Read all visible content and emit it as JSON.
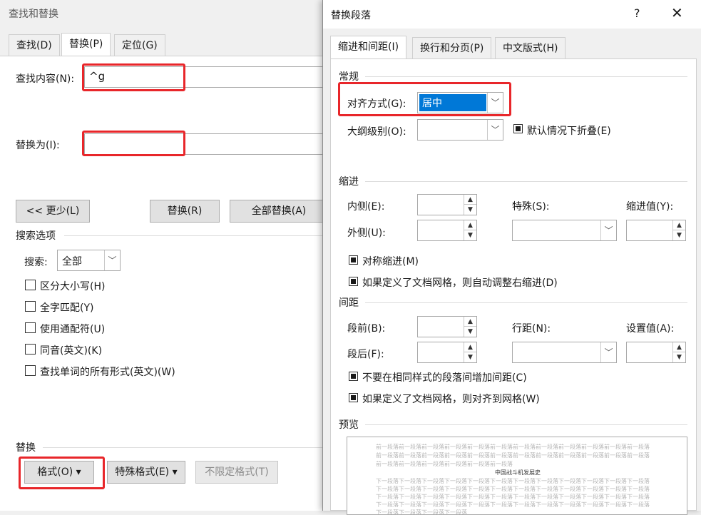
{
  "find_replace": {
    "title": "查找和替换",
    "tabs": [
      "查找(D)",
      "替换(P)",
      "定位(G)"
    ],
    "find_label": "查找内容(N):",
    "find_value": "^g",
    "replace_label": "替换为(I):",
    "replace_value": "",
    "less_button": "<< 更少(L)",
    "replace_button": "替换(R)",
    "replace_all_button": "全部替换(A)",
    "search_options_title": "搜索选项",
    "search_label": "搜索:",
    "search_value": "全部",
    "options": [
      "区分大小写(H)",
      "全字匹配(Y)",
      "使用通配符(U)",
      "同音(英文)(K)",
      "查找单词的所有形式(英文)(W)"
    ],
    "replace_section": "替换",
    "format_button": "格式(O) ▾",
    "special_button": "特殊格式(E) ▾",
    "no_format_button": "不限定格式(T)"
  },
  "paragraph": {
    "title": "替换段落",
    "help": "?",
    "close": "✕",
    "tabs": [
      "缩进和间距(I)",
      "换行和分页(P)",
      "中文版式(H)"
    ],
    "general": {
      "title": "常规",
      "align_label": "对齐方式(G):",
      "align_value": "居中",
      "outline_label": "大纲级别(O):",
      "outline_value": "",
      "collapse_label": "默认情况下折叠(E)"
    },
    "indent": {
      "title": "缩进",
      "inside_label": "内侧(E):",
      "outside_label": "外侧(U):",
      "special_label": "特殊(S):",
      "indent_value_label": "缩进值(Y):",
      "mirror_label": "对称缩进(M)",
      "auto_adjust_label": "如果定义了文档网格，则自动调整右缩进(D)"
    },
    "spacing": {
      "title": "间距",
      "before_label": "段前(B):",
      "after_label": "段后(F):",
      "line_label": "行距(N):",
      "set_value_label": "设置值(A):",
      "no_space_label": "不要在相同样式的段落间增加间距(C)",
      "snap_grid_label": "如果定义了文档网格，则对齐到网格(W)"
    },
    "preview": {
      "title": "预览",
      "prev_lines": [
        "前一段落前一段落前一段落前一段落前一段落前一段落前一段落前一段落前一段落前一段落前一段落前一段落",
        "前一段落前一段落前一段落前一段落前一段落前一段落前一段落前一段落前一段落前一段落前一段落前一段落",
        "前一段落前一段落前一段落前一段落前一段落前一段落"
      ],
      "sample_text": "中国战斗机发展史",
      "next_lines": [
        "下一段落下一段落下一段落下一段落下一段落下一段落下一段落下一段落下一段落下一段落下一段落下一段落",
        "下一段落下一段落下一段落下一段落下一段落下一段落下一段落下一段落下一段落下一段落下一段落下一段落",
        "下一段落下一段落下一段落下一段落下一段落下一段落下一段落下一段落下一段落下一段落下一段落下一段落",
        "下一段落下一段落下一段落下一段落下一段落下一段落下一段落下一段落下一段落下一段落下一段落下一段落",
        "下一段落下一段落下一段落下一段落"
      ]
    }
  },
  "colors": {
    "highlight": "#e8262a",
    "selection": "#0078d7"
  }
}
